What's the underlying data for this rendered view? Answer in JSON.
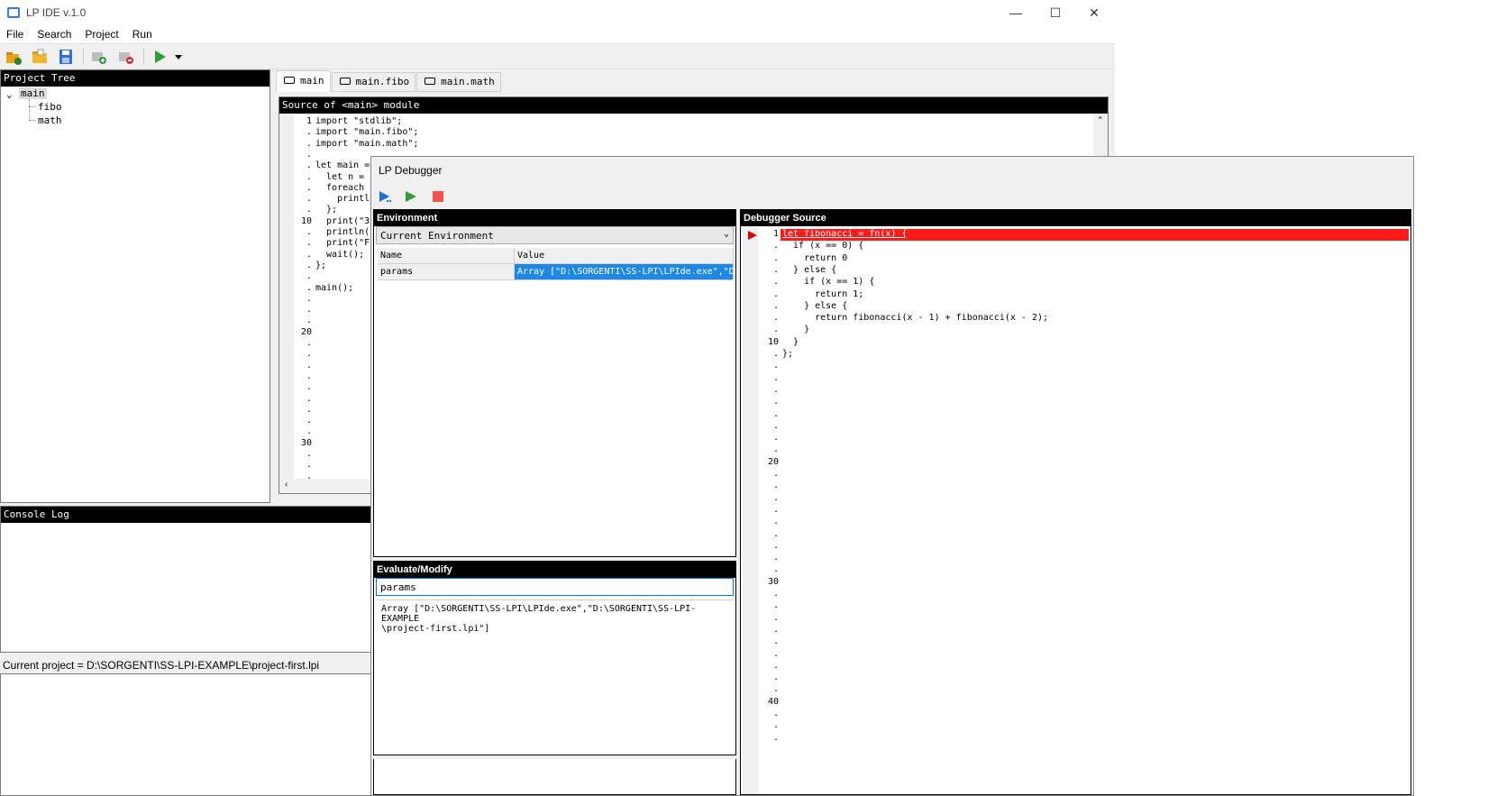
{
  "window": {
    "title": "LP IDE v.1.0",
    "min": "—",
    "max": "☐",
    "close": "✕"
  },
  "menu": [
    "File",
    "Search",
    "Project",
    "Run"
  ],
  "tree": {
    "header": "Project Tree",
    "root": "main",
    "children": [
      "fibo",
      "math"
    ]
  },
  "tabs": [
    "main",
    "main.fibo",
    "main.math"
  ],
  "editor": {
    "header": "Source of <main> module",
    "line_numbers": [
      "1",
      ".",
      ".",
      ".",
      ".",
      ".",
      ".",
      ".",
      ".",
      "10",
      ".",
      ".",
      ".",
      ".",
      ".",
      ".",
      ".",
      ".",
      ".",
      "20",
      ".",
      ".",
      ".",
      ".",
      ".",
      ".",
      ".",
      ".",
      ".",
      "30",
      ".",
      ".",
      "."
    ],
    "lines": [
      "import \"stdlib\";",
      "import \"main.fibo\";",
      "import \"main.math\";",
      "",
      "let main =",
      "  let n = 1",
      "  foreach v",
      "    println",
      "  };",
      "  print(\"3",
      "  println(\"",
      "  print(\"Fi",
      "  wait();",
      "};",
      "",
      "main();"
    ]
  },
  "console": {
    "header": "Console Log"
  },
  "status": {
    "text": "Current project = D:\\SORGENTI\\SS-LPI-EXAMPLE\\project-first.lpi"
  },
  "debugger": {
    "title": "LP Debugger",
    "environment": {
      "header": "Environment",
      "selected": "Current Environment",
      "columns": [
        "Name",
        "Value"
      ],
      "rows": [
        {
          "name": "params",
          "value": "Array [\"D:\\SORGENTI\\SS-LPI\\LPIde.exe\",\"D:\\"
        }
      ]
    },
    "evaluate": {
      "header": "Evaluate/Modify",
      "input": "params",
      "output": "Array [\"D:\\SORGENTI\\SS-LPI\\LPIde.exe\",\"D:\\SORGENTI\\SS-LPI-EXAMPLE\n\\project-first.lpi\"]"
    },
    "source": {
      "header": "Debugger Source",
      "line_numbers": [
        "1",
        ".",
        ".",
        ".",
        ".",
        ".",
        ".",
        ".",
        ".",
        "10",
        ".",
        ".",
        ".",
        ".",
        ".",
        ".",
        ".",
        ".",
        ".",
        "20",
        ".",
        ".",
        ".",
        ".",
        ".",
        ".",
        ".",
        ".",
        ".",
        "30",
        ".",
        ".",
        ".",
        ".",
        ".",
        ".",
        ".",
        ".",
        ".",
        "40",
        ".",
        ".",
        "."
      ],
      "lines": [
        "let fibonacci = fn(x) {",
        "  if (x == 0) {",
        "    return 0",
        "  } else {",
        "    if (x == 1) {",
        "      return 1;",
        "    } else {",
        "      return fibonacci(x - 1) + fibonacci(x - 2);",
        "    }",
        "  }",
        "};"
      ]
    }
  },
  "colors": {
    "accent": "#1e88e5",
    "breakpoint_line": "#ff1a1a",
    "panel_header": "#000000"
  }
}
